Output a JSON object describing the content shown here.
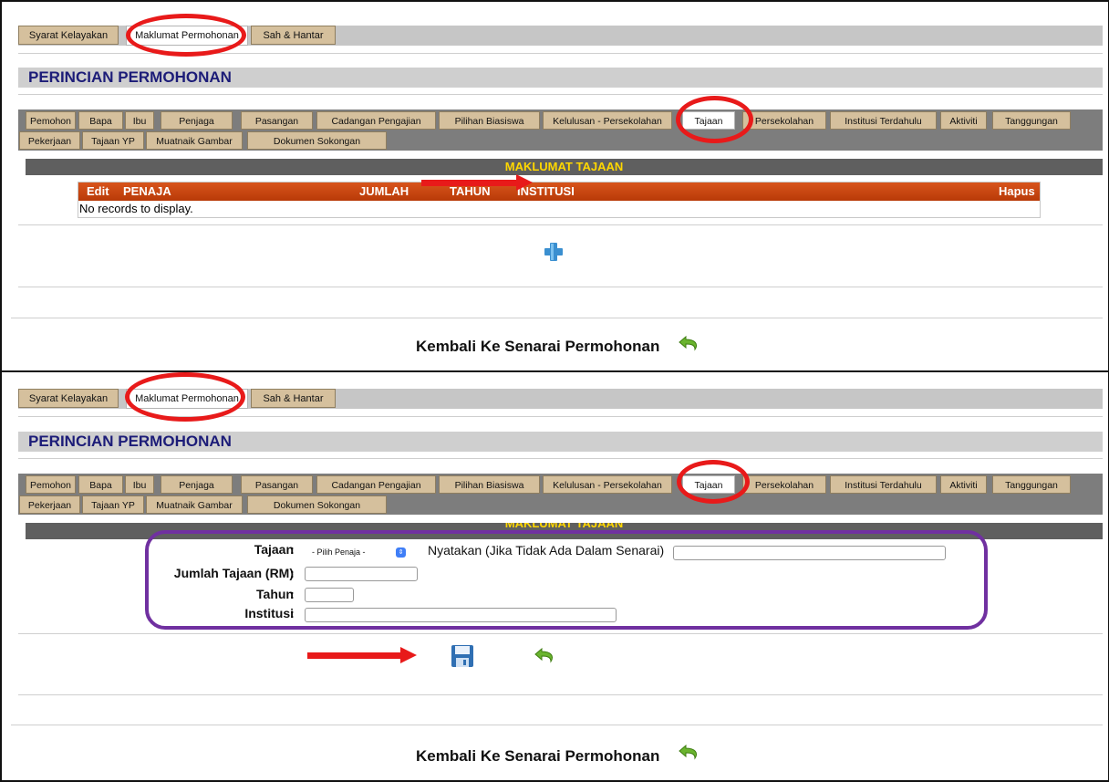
{
  "top_tabs": [
    "Syarat Kelayakan",
    "Maklumat Permohonan",
    "Sah & Hantar"
  ],
  "page_title": "PERINCIAN PERMOHONAN",
  "sub_tabs_row1": [
    "Pemohon",
    "Bapa",
    "Ibu",
    "Penjaga",
    "Pasangan",
    "Cadangan Pengajian",
    "Pilihan Biasiswa",
    "Kelulusan - Persekolahan",
    "Tajaan",
    "Persekolahan",
    "Institusi Terdahulu",
    "Aktiviti",
    "Tanggungan"
  ],
  "sub_tabs_row2": [
    "Pekerjaan",
    "Tajaan YP",
    "Muatnaik Gambar",
    "Dokumen Sokongan"
  ],
  "section_title": "MAKLUMAT TAJAAN",
  "grid": {
    "columns": [
      "Edit",
      "PENAJA",
      "JUMLAH",
      "TAHUN",
      "INSTITUSI",
      "Hapus"
    ],
    "empty_message": "No records to display."
  },
  "form": {
    "tajaan_label": "Tajaan",
    "tajaan_select_value": "- Pilih Penaja -",
    "nyatakan_label": "Nyatakan (Jika Tidak Ada Dalam Senarai)",
    "jumlah_label": "Jumlah Tajaan (RM)",
    "tahun_label": "Tahun",
    "institusi_label": "Institusi",
    "colon": ":"
  },
  "back_link_text": "Kembali Ke Senarai Permohonan",
  "icons": {
    "add": "plus-icon",
    "save": "floppy-save-icon",
    "back": "undo-arrow-icon"
  },
  "colors": {
    "tab_bg": "#d5c09d",
    "grid_header": "#c8480f",
    "section_title": "#ffd700",
    "annotation_red": "#e81a1a",
    "annotation_purple": "#7030a0",
    "title_blue": "#1c1c78"
  }
}
